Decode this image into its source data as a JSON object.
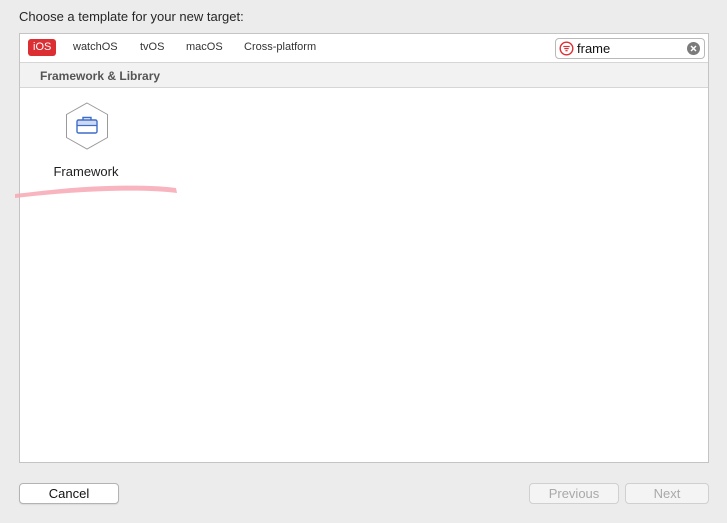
{
  "dialog": {
    "heading": "Choose a template for your new target:"
  },
  "platform_tabs": [
    {
      "label": "iOS",
      "selected": true
    },
    {
      "label": "watchOS",
      "selected": false
    },
    {
      "label": "tvOS",
      "selected": false
    },
    {
      "label": "macOS",
      "selected": false
    },
    {
      "label": "Cross-platform",
      "selected": false
    }
  ],
  "search": {
    "value": "frame",
    "filter_icon": "filter-icon",
    "clear_icon": "clear-icon"
  },
  "section": {
    "title": "Framework & Library"
  },
  "templates": [
    {
      "label": "Framework",
      "icon": "framework-toolbox-icon",
      "highlighted": true
    }
  ],
  "buttons": {
    "cancel": "Cancel",
    "previous": "Previous",
    "next": "Next"
  },
  "colors": {
    "accent_red": "#db2f34",
    "icon_blue": "#3d6bc9",
    "highlight_pink": "#f7a8b4"
  }
}
